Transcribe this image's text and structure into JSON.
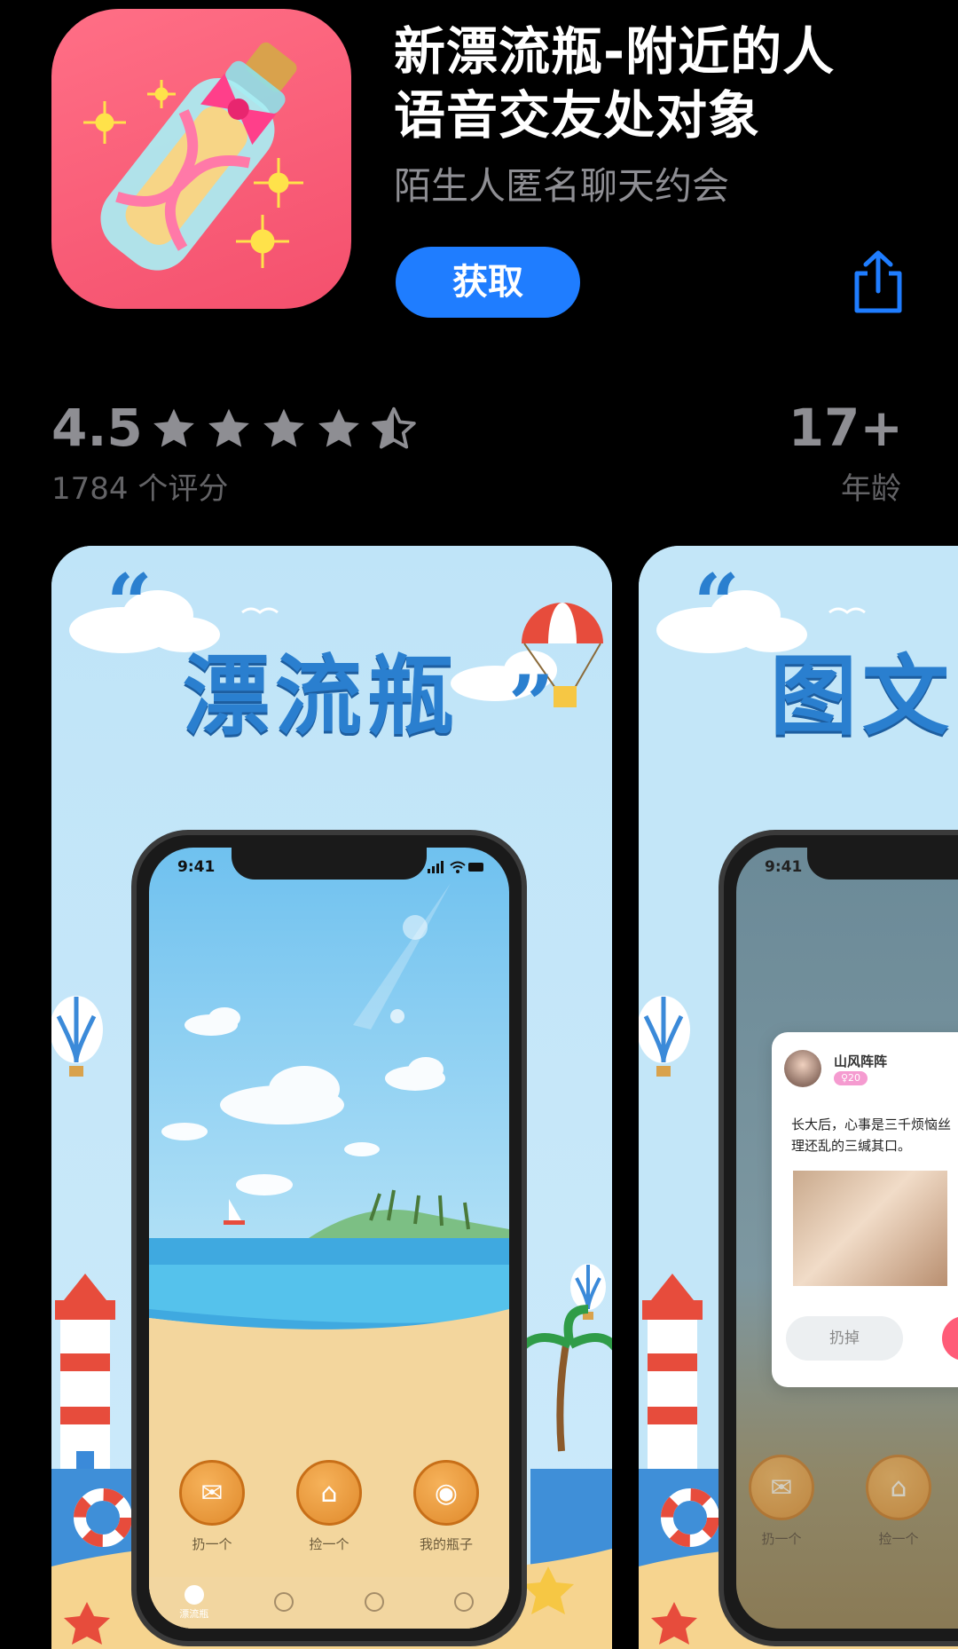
{
  "app": {
    "title_line1": "新漂流瓶-附近的人",
    "title_line2": "语音交友处对象",
    "subtitle": "陌生人匿名聊天约会",
    "get_label": "获取",
    "icon_name": "message-in-a-bottle-icon",
    "share_icon": "share-icon"
  },
  "ratings": {
    "value": "4.5",
    "stars": 4.5,
    "count_label": "1784 个评分"
  },
  "age": {
    "value": "17+",
    "label": "年龄"
  },
  "screenshots": [
    {
      "banner": "漂流瓶",
      "quote_open": "“",
      "quote_close": "”",
      "status_time": "9:41",
      "buttons": [
        {
          "label": "扔一个",
          "icon": "bottle-icon"
        },
        {
          "label": "捡一个",
          "icon": "net-icon"
        },
        {
          "label": "我的瓶子",
          "icon": "bucket-icon"
        }
      ],
      "tabs": [
        {
          "label": "漂流瓶",
          "icon": "bottle-tab-icon"
        },
        {
          "label": "",
          "icon": "profile-tab-icon"
        },
        {
          "label": "",
          "icon": "chat-tab-icon"
        },
        {
          "label": "",
          "icon": "me-tab-icon"
        }
      ]
    },
    {
      "banner": "图文",
      "quote_open": "“",
      "status_time": "9:41",
      "card": {
        "name": "山风阵阵",
        "badge": "♀20",
        "text_line1": "长大后，心事是三千烦恼丝",
        "text_line2": "理还乱的三缄其口。",
        "discard_label": "扔掉"
      },
      "buttons": [
        {
          "label": "扔一个",
          "icon": "bottle-icon"
        },
        {
          "label": "捡一个",
          "icon": "net-icon"
        }
      ]
    }
  ],
  "colors": {
    "background": "#000000",
    "accent": "#1f7dff",
    "secondary_text": "#8e8e93",
    "tertiary_text": "#636366",
    "icon_bg": "#f4506d",
    "screenshot_sky": "#c3e6f8"
  }
}
